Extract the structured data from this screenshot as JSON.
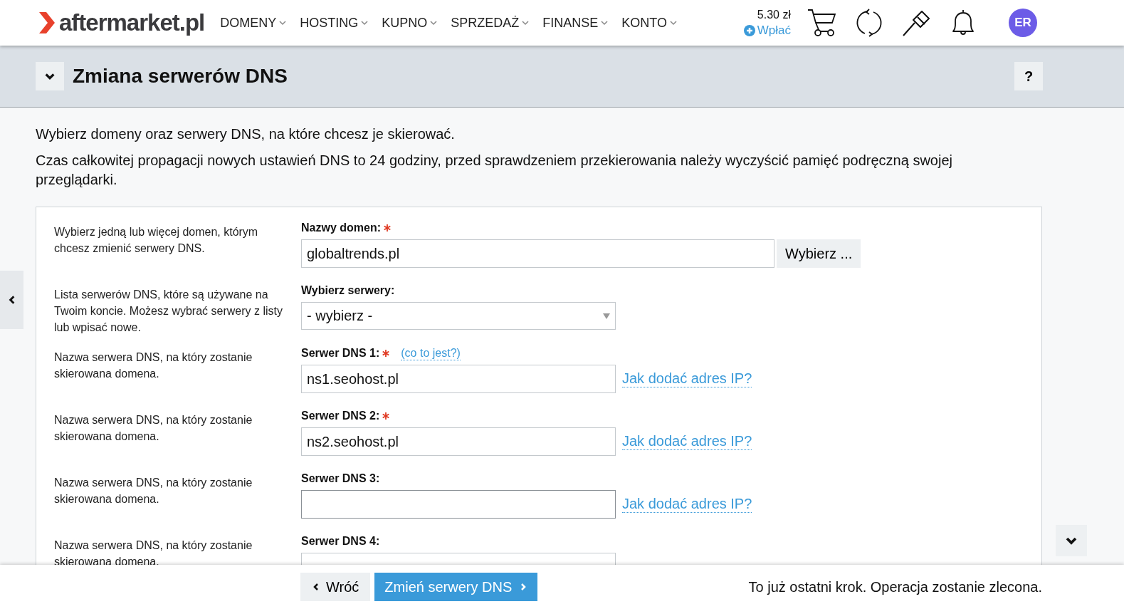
{
  "header": {
    "logo": "aftermarket.pl",
    "nav": [
      {
        "label": "DOMENY"
      },
      {
        "label": "HOSTING"
      },
      {
        "label": "KUPNO"
      },
      {
        "label": "SPRZEDAŻ"
      },
      {
        "label": "FINANSE"
      },
      {
        "label": "KONTO"
      }
    ],
    "balance": "5.30 zł",
    "deposit": "Wpłać",
    "avatar": "ER"
  },
  "title_bar": {
    "title": "Zmiana serwerów DNS",
    "help": "?"
  },
  "intro": [
    "Wybierz domeny oraz serwery DNS, na które chcesz je skierować.",
    "Czas całkowitej propagacji nowych ustawień DNS to 24 godziny, przed sprawdzeniem przekierowania należy wyczyścić pamięć podręczną swojej przeglądarki."
  ],
  "form_rows": [
    {
      "kind": "domains",
      "description": "Wybierz jedną lub więcej domen, którym chcesz zmienić serwery DNS.",
      "label": "Nazwy domen:",
      "required": true,
      "value": "globaltrends.pl",
      "button": "Wybierz ..."
    },
    {
      "kind": "select",
      "description": "Lista serwerów DNS, które są używane na Twoim koncie. Możesz wybrać serwery z listy lub wpisać nowe.",
      "label": "Wybierz serwery:",
      "required": false,
      "value": "- wybierz -"
    },
    {
      "kind": "dns",
      "description": "Nazwa serwera DNS, na który zostanie skierowana domena.",
      "label": "Serwer DNS 1:",
      "required": true,
      "help": "(co to jest?)",
      "value": "ns1.seohost.pl",
      "link": "Jak dodać adres IP?"
    },
    {
      "kind": "dns",
      "description": "Nazwa serwera DNS, na który zostanie skierowana domena.",
      "label": "Serwer DNS 2:",
      "required": true,
      "value": "ns2.seohost.pl",
      "link": "Jak dodać adres IP?"
    },
    {
      "kind": "dns",
      "description": "Nazwa serwera DNS, na który zostanie skierowana domena.",
      "label": "Serwer DNS 3:",
      "required": false,
      "focused": true,
      "link": "Jak dodać adres IP?"
    },
    {
      "kind": "dns",
      "description": "Nazwa serwera DNS, na który zostanie skierowana domena.",
      "label": "Serwer DNS 4:",
      "required": false
    }
  ],
  "footer": {
    "back": "Wróć",
    "submit": "Zmień serwery DNS",
    "note": "To już ostatni krok. Operacja zostanie zlecona."
  }
}
